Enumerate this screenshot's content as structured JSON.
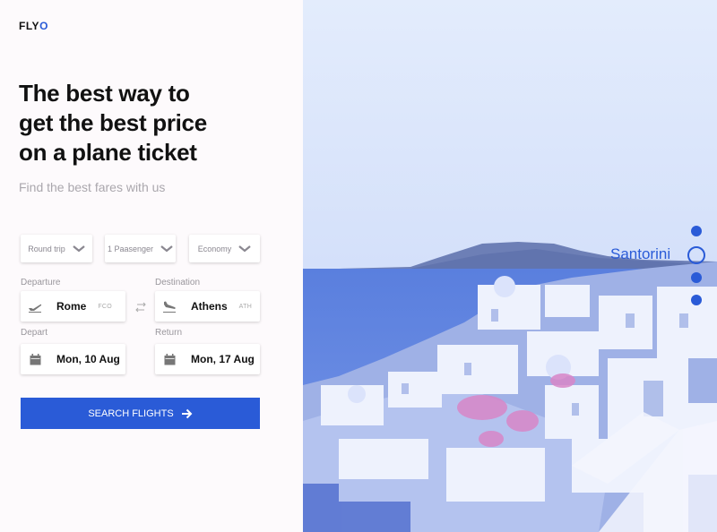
{
  "logo": {
    "text_main": "FLY",
    "text_accent": "O"
  },
  "hero": {
    "line1": "The best way to",
    "line2": "get the best price",
    "line3": "on a plane ticket",
    "subtitle": "Find the best fares with us"
  },
  "options": {
    "trip_type": "Round trip",
    "passengers": "1 Paasenger",
    "cabin": "Economy"
  },
  "route": {
    "departure_label": "Departure",
    "destination_label": "Destination",
    "from_city": "Rome",
    "from_code": "FCO",
    "to_city": "Athens",
    "to_code": "ATH"
  },
  "dates": {
    "depart_label": "Depart",
    "return_label": "Return",
    "depart_value": "Mon, 10 Aug",
    "return_value": "Mon, 17 Aug"
  },
  "search_button": "SEARCH FLIGHTS",
  "carousel": {
    "active_label": "Santorini",
    "slide_count": 4,
    "active_index": 1
  },
  "colors": {
    "accent": "#2a5bd7",
    "sky": "#dce6fb",
    "sea": "#5e84e0"
  },
  "icons": [
    "chevron-down-icon",
    "plane-departure-icon",
    "plane-arrival-icon",
    "swap-icon",
    "calendar-icon",
    "arrow-right-icon"
  ]
}
